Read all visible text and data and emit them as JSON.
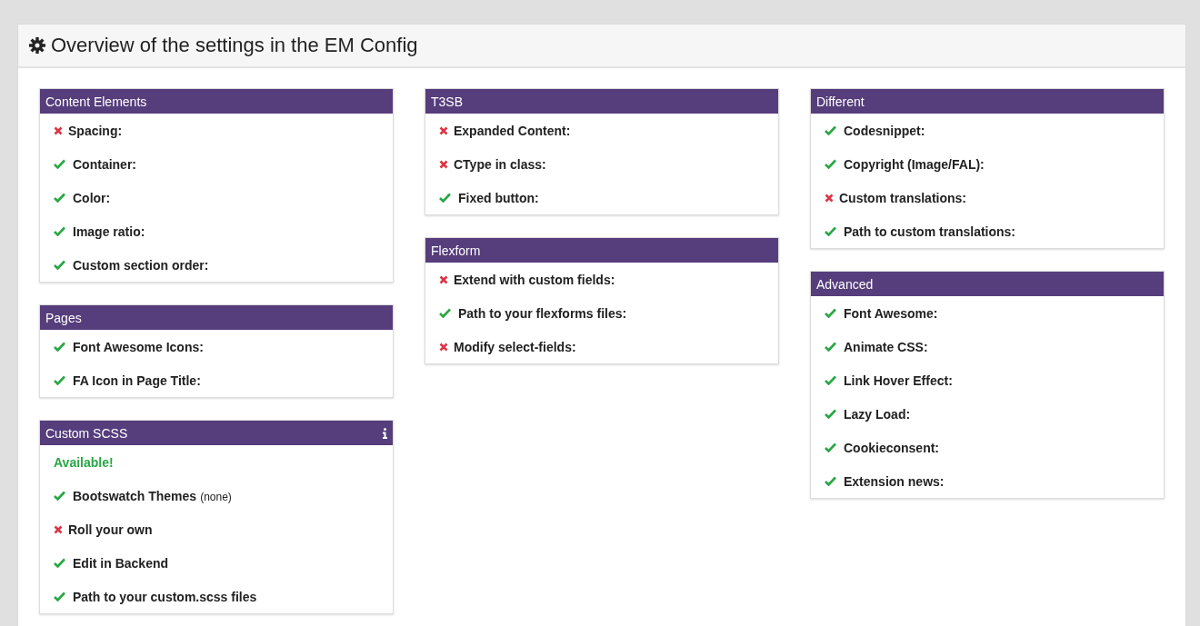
{
  "title": "Overview of the settings in the EM Config",
  "columns": [
    [
      {
        "title": "Content Elements",
        "info": false,
        "items": [
          {
            "label": "Spacing:",
            "enabled": false
          },
          {
            "label": "Container:",
            "enabled": true
          },
          {
            "label": "Color:",
            "enabled": true
          },
          {
            "label": "Image ratio:",
            "enabled": true
          },
          {
            "label": "Custom section order:",
            "enabled": true
          }
        ]
      },
      {
        "title": "Pages",
        "info": false,
        "items": [
          {
            "label": "Font Awesome Icons:",
            "enabled": true
          },
          {
            "label": "FA Icon in Page Title:",
            "enabled": true
          }
        ]
      },
      {
        "title": "Custom SCSS",
        "info": true,
        "status": "Available!",
        "items": [
          {
            "label": "Bootswatch Themes",
            "note": "(none)",
            "enabled": true
          },
          {
            "label": "Roll your own",
            "enabled": false
          },
          {
            "label": "Edit in Backend",
            "enabled": true
          },
          {
            "label": "Path to your custom.scss files",
            "enabled": true
          }
        ]
      }
    ],
    [
      {
        "title": "T3SB",
        "info": false,
        "items": [
          {
            "label": "Expanded Content:",
            "enabled": false
          },
          {
            "label": "CType in class:",
            "enabled": false
          },
          {
            "label": "Fixed button:",
            "enabled": true
          }
        ]
      },
      {
        "title": "Flexform",
        "info": false,
        "items": [
          {
            "label": "Extend with custom fields:",
            "enabled": false
          },
          {
            "label": "Path to your flexforms files:",
            "enabled": true
          },
          {
            "label": "Modify select-fields:",
            "enabled": false
          }
        ]
      }
    ],
    [
      {
        "title": "Different",
        "info": false,
        "items": [
          {
            "label": "Codesnippet:",
            "enabled": true
          },
          {
            "label": "Copyright (Image/FAL):",
            "enabled": true
          },
          {
            "label": "Custom translations:",
            "enabled": false
          },
          {
            "label": "Path to custom translations:",
            "enabled": true
          }
        ]
      },
      {
        "title": "Advanced",
        "info": false,
        "items": [
          {
            "label": "Font Awesome:",
            "enabled": true
          },
          {
            "label": "Animate CSS:",
            "enabled": true
          },
          {
            "label": "Link Hover Effect:",
            "enabled": true
          },
          {
            "label": "Lazy Load:",
            "enabled": true
          },
          {
            "label": "Cookieconsent:",
            "enabled": true
          },
          {
            "label": "Extension news:",
            "enabled": true
          }
        ]
      }
    ]
  ]
}
